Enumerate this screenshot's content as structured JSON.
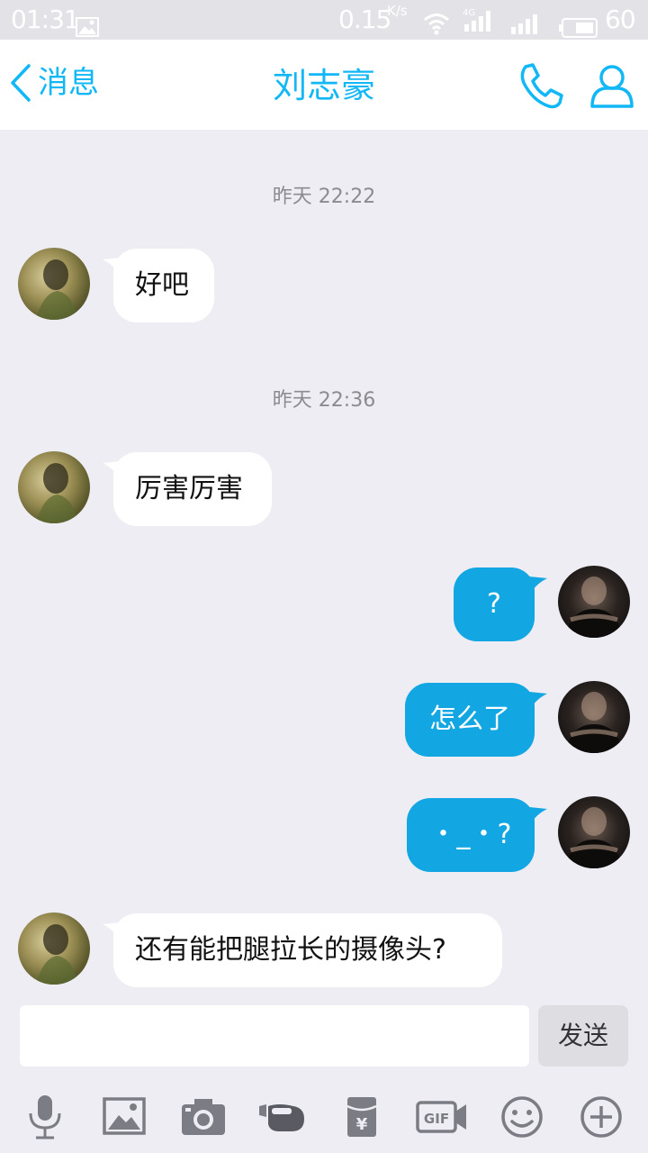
{
  "status_bar": {
    "time": "01:31",
    "speed": "0.15",
    "speed_unit": "K/s",
    "network": "4G",
    "battery": "60",
    "icons": [
      "image-icon",
      "wifi-icon",
      "signal-icon",
      "battery-icon"
    ]
  },
  "nav": {
    "back_label": "消息",
    "title": "刘志豪",
    "icons": [
      "chevron-left-icon",
      "phone-icon",
      "profile-icon"
    ]
  },
  "messages": [
    {
      "type": "time",
      "text": "昨天 22:22"
    },
    {
      "type": "in",
      "text": "好吧"
    },
    {
      "type": "time",
      "text": "昨天 22:36"
    },
    {
      "type": "in",
      "text": "厉害厉害"
    },
    {
      "type": "out",
      "text": "?"
    },
    {
      "type": "out",
      "text": "怎么了"
    },
    {
      "type": "out",
      "text": "・_・?"
    },
    {
      "type": "in",
      "text": "还有能把腿拉长的摄像头?"
    }
  ],
  "input": {
    "value": "",
    "placeholder": "",
    "send_label": "发送"
  },
  "toolbar": {
    "icons": [
      "microphone-icon",
      "image-icon",
      "camera-icon",
      "poke-icon",
      "red-packet-icon",
      "gif-icon",
      "emoji-icon",
      "plus-icon"
    ]
  },
  "colors": {
    "accent": "#12b7f5",
    "outgoing_bubble": "#12a7e3",
    "incoming_bubble": "#ffffff",
    "background": "#ededf3"
  }
}
